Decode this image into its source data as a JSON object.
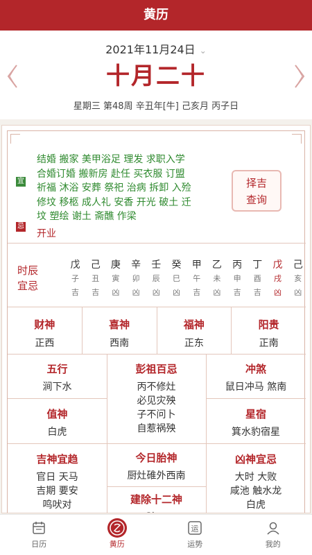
{
  "header": {
    "title": "黄历"
  },
  "date": {
    "solar": "2021年11月24日",
    "lunar": "十月二十",
    "info": "星期三 第48周 辛丑年[牛] 己亥月 丙子日"
  },
  "yiji": {
    "yi_label": "宜",
    "ji_label": "忌",
    "yi_lines": [
      "结婚 搬家 美甲浴足 理发 求职入学",
      "合婚订婚 搬新房 赴任 买衣服 订盟",
      "祈福 沐浴 安葬 祭祀 治病 拆卸 入殓",
      "修坟 移柩 成人礼 安香 开光 破土 迁",
      "坟 塑绘 谢土 斋醮 作梁"
    ],
    "ji": "开业",
    "zeji_line1": "择吉",
    "zeji_line2": "查询"
  },
  "hours": {
    "title_line1": "时辰",
    "title_line2": "宜忌",
    "items": [
      {
        "gan": "戊",
        "zhi": "子",
        "luck": "吉"
      },
      {
        "gan": "己",
        "zhi": "丑",
        "luck": "吉"
      },
      {
        "gan": "庚",
        "zhi": "寅",
        "luck": "凶"
      },
      {
        "gan": "辛",
        "zhi": "卯",
        "luck": "凶"
      },
      {
        "gan": "壬",
        "zhi": "辰",
        "luck": "凶"
      },
      {
        "gan": "癸",
        "zhi": "巳",
        "luck": "凶"
      },
      {
        "gan": "甲",
        "zhi": "午",
        "luck": "吉"
      },
      {
        "gan": "乙",
        "zhi": "未",
        "luck": "凶"
      },
      {
        "gan": "丙",
        "zhi": "申",
        "luck": "吉"
      },
      {
        "gan": "丁",
        "zhi": "酉",
        "luck": "吉"
      },
      {
        "gan": "戊",
        "zhi": "戌",
        "luck": "凶"
      },
      {
        "gan": "己",
        "zhi": "亥",
        "luck": "凶"
      }
    ]
  },
  "gods": [
    {
      "title": "财神",
      "value": "正西"
    },
    {
      "title": "喜神",
      "value": "西南"
    },
    {
      "title": "福神",
      "value": "正东"
    },
    {
      "title": "阳贵",
      "value": "正南"
    }
  ],
  "grid": {
    "wuxing": {
      "title": "五行",
      "value": "涧下水"
    },
    "zhishen": {
      "title": "值神",
      "value": "白虎"
    },
    "pengzu": {
      "title": "彭祖百忌",
      "line1": "丙不修灶",
      "line2": "必见灾殃",
      "line3": "子不问卜",
      "line4": "自惹祸殃"
    },
    "chongsha": {
      "title": "冲煞",
      "value": "鼠日冲马 煞南"
    },
    "xingxiu": {
      "title": "星宿",
      "value": "箕水豹宿星"
    },
    "taishen": {
      "title": "今日胎神",
      "value": "厨灶碓外西南"
    },
    "jianchu": {
      "title": "建除十二神",
      "value": "除日"
    },
    "jishen": {
      "title": "吉神宜趋",
      "line1": "官日 天马",
      "line2": "吉期 要安",
      "line3": "鸣吠对"
    },
    "xiongshen": {
      "title": "凶神宜忌",
      "line1": "大时 大败",
      "line2": "咸池 触水龙",
      "line3": "白虎"
    }
  },
  "nav": [
    {
      "label": "日历",
      "icon": "calendar-icon"
    },
    {
      "label": "黄历",
      "icon": "almanac-seal-icon"
    },
    {
      "label": "运势",
      "icon": "fortune-icon"
    },
    {
      "label": "我的",
      "icon": "profile-icon"
    }
  ],
  "colors": {
    "accent": "#b3262a",
    "yi": "#2f8a2f"
  }
}
